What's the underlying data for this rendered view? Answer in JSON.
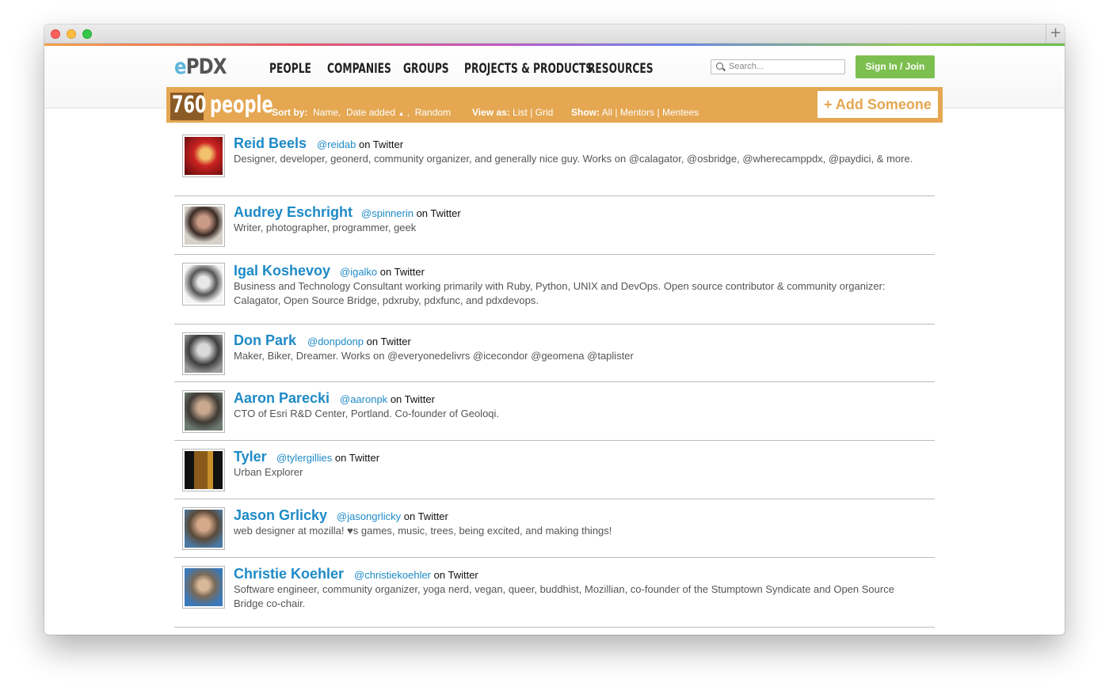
{
  "window": {
    "new_tab_symbol": "+"
  },
  "logo": {
    "e": "e",
    "pdx": "PDX"
  },
  "nav": [
    "PEOPLE",
    "COMPANIES",
    "GROUPS",
    "PROJECTS & PRODUCTS",
    "RESOURCES"
  ],
  "search": {
    "placeholder": "Search..."
  },
  "signin_label": "Sign In / Join",
  "bar": {
    "count": "760",
    "word": "people",
    "sort_label": "Sort by:",
    "sort_options": [
      "Name,",
      "Date added",
      ",",
      "Random"
    ],
    "sort_arrow": "▲",
    "view_label": "View as:",
    "view_options": [
      "List",
      "|",
      "Grid"
    ],
    "show_label": "Show:",
    "show_options": [
      "All",
      "|",
      "Mentors",
      "|",
      "Mentees"
    ],
    "add_label": "+ Add Someone"
  },
  "twitter_suffix": "on Twitter",
  "people": [
    {
      "name": "Reid Beels",
      "handle": "@reidab",
      "bio": "Designer, developer, geonerd, community organizer, and generally nice guy. Works on @calagator, @osbridge, @wherecamppdx, @paydici, & more."
    },
    {
      "name": "Audrey Eschright",
      "handle": "@spinnerin",
      "bio": "Writer, photographer, programmer, geek"
    },
    {
      "name": "Igal Koshevoy",
      "handle": "@igalko",
      "bio": "Business and Technology Consultant working primarily with Ruby, Python, UNIX and DevOps. Open source contributor & community organizer: Calagator, Open Source Bridge, pdxruby, pdxfunc, and pdxdevops."
    },
    {
      "name": "Don Park",
      "handle": "@donpdonp",
      "bio": "Maker, Biker, Dreamer. Works on @everyonedelivrs @icecondor @geomena @taplister"
    },
    {
      "name": "Aaron Parecki",
      "handle": "@aaronpk",
      "bio": "CTO of Esri R&D Center, Portland. Co-founder of Geoloqi."
    },
    {
      "name": "Tyler",
      "handle": "@tylergillies",
      "bio": "Urban Explorer"
    },
    {
      "name": "Jason Grlicky",
      "handle": "@jasongrlicky",
      "bio": "web designer at mozilla! ♥s games, music, trees, being excited, and making things!"
    },
    {
      "name": "Christie Koehler",
      "handle": "@christiekoehler",
      "bio": "Software engineer, community organizer, yoga nerd, vegan, queer, buddhist, Mozillian, co-founder of the Stumptown Syndicate and Open Source Bridge co-chair."
    }
  ]
}
